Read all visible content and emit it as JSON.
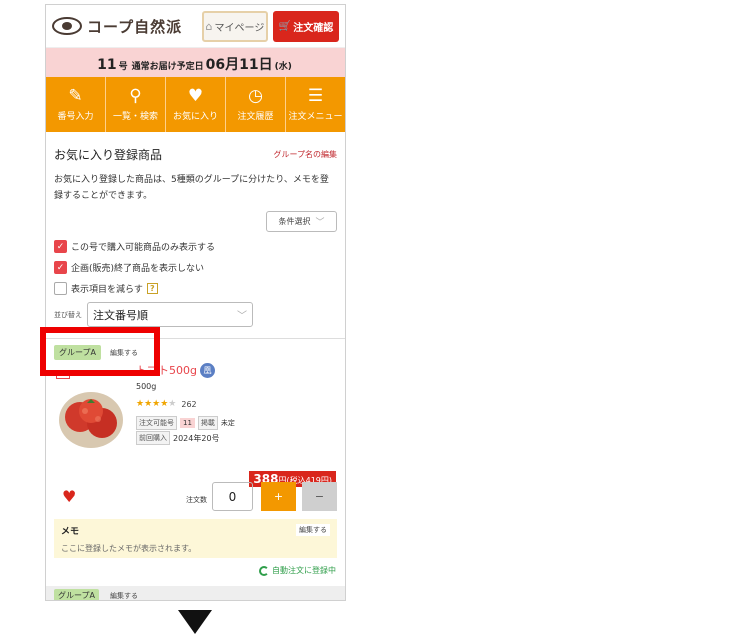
{
  "header": {
    "logo_text": "コープ自然派",
    "mypage_label": "マイページ",
    "order_confirm_label": "注文確認"
  },
  "delivery": {
    "issue_num": "11",
    "issue_suffix": "号",
    "label": "通常お届け予定日",
    "date_main": "06月11日",
    "weekday": "(水)"
  },
  "nav": {
    "items": [
      {
        "label": "番号入力",
        "icon": "pencil-icon"
      },
      {
        "label": "一覧・検索",
        "icon": "search-icon"
      },
      {
        "label": "お気に入り",
        "icon": "heart-icon"
      },
      {
        "label": "注文履歴",
        "icon": "clock-icon"
      },
      {
        "label": "注文メニュー",
        "icon": "menu-icon"
      }
    ]
  },
  "favorites": {
    "title": "お気に入り登録商品",
    "group_edit_link": "グループ名の編集",
    "description": "お気に入り登録した商品は、5種類のグループに分けたり、メモを登録することができます。",
    "condition_button": "条件選択",
    "checkboxes": [
      {
        "label": "この号で購入可能商品のみ表示する",
        "checked": true
      },
      {
        "label": "企画(販売)終了商品を表示しない",
        "checked": true
      },
      {
        "label": "表示項目を減らす",
        "checked": false
      }
    ],
    "sort_label": "並び替え",
    "sort_value": "注文番号順"
  },
  "item": {
    "group": "グループA",
    "group_edit": "編集する",
    "name": "トマト500g",
    "badge": "凰",
    "weight": "500g",
    "rating": 4,
    "review_count": "262",
    "order_no_label": "注文可能号",
    "order_no_value": "11",
    "listing_label": "掲載",
    "listing_value": "未定",
    "last_purchase_label": "前回購入",
    "last_purchase_value": "2024年20号",
    "price": "388",
    "price_tax": "円(税込419円)",
    "qty_label": "注文数",
    "qty_value": "0",
    "plus": "+",
    "minus": "−",
    "memo_title": "メモ",
    "memo_edit": "編集する",
    "memo_text": "ここに登録したメモが表示されます。",
    "auto_order": "自動注文に登録中"
  },
  "next_item": {
    "group": "グループA",
    "group_edit": "編集する"
  },
  "colors": {
    "orange": "#f39800",
    "red": "#d9261c",
    "pink": "#f9d3d3",
    "green_tag": "#bfe0a0",
    "highlight": "#ee0000"
  }
}
